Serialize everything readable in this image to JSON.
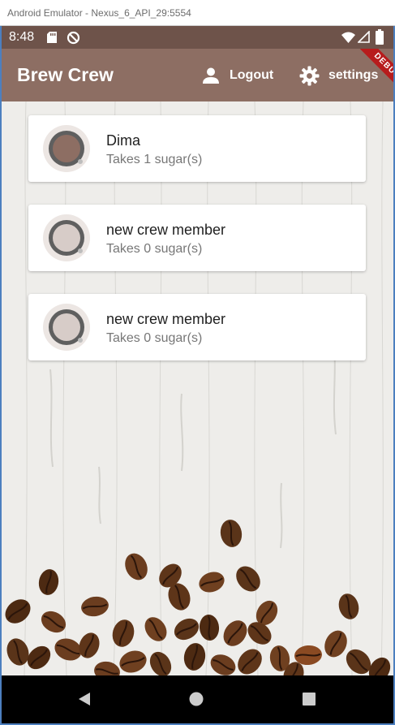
{
  "window": {
    "title": "Android Emulator - Nexus_6_API_29:5554"
  },
  "status_bar": {
    "time": "8:48"
  },
  "app_bar": {
    "title": "Brew Crew",
    "logout_label": "Logout",
    "settings_label": "settings"
  },
  "debug_banner": "DEBUG",
  "members": [
    {
      "name": "Dima",
      "subtitle": "Takes 1 sugar(s)",
      "cup_color": "#8d6e63"
    },
    {
      "name": "new crew member",
      "subtitle": "Takes 0 sugar(s)",
      "cup_color": "#d7ccc8"
    },
    {
      "name": "new crew member",
      "subtitle": "Takes 0 sugar(s)",
      "cup_color": "#d7ccc8"
    }
  ],
  "colors": {
    "status_bar": "#6e534a",
    "app_bar": "#8d6e63",
    "debug": "#b71c1c"
  },
  "icons": [
    "sd-card-icon",
    "data-saver-icon",
    "wifi-icon",
    "signal-icon",
    "battery-icon",
    "person-icon",
    "gear-icon",
    "back-icon",
    "home-icon",
    "recents-icon"
  ]
}
